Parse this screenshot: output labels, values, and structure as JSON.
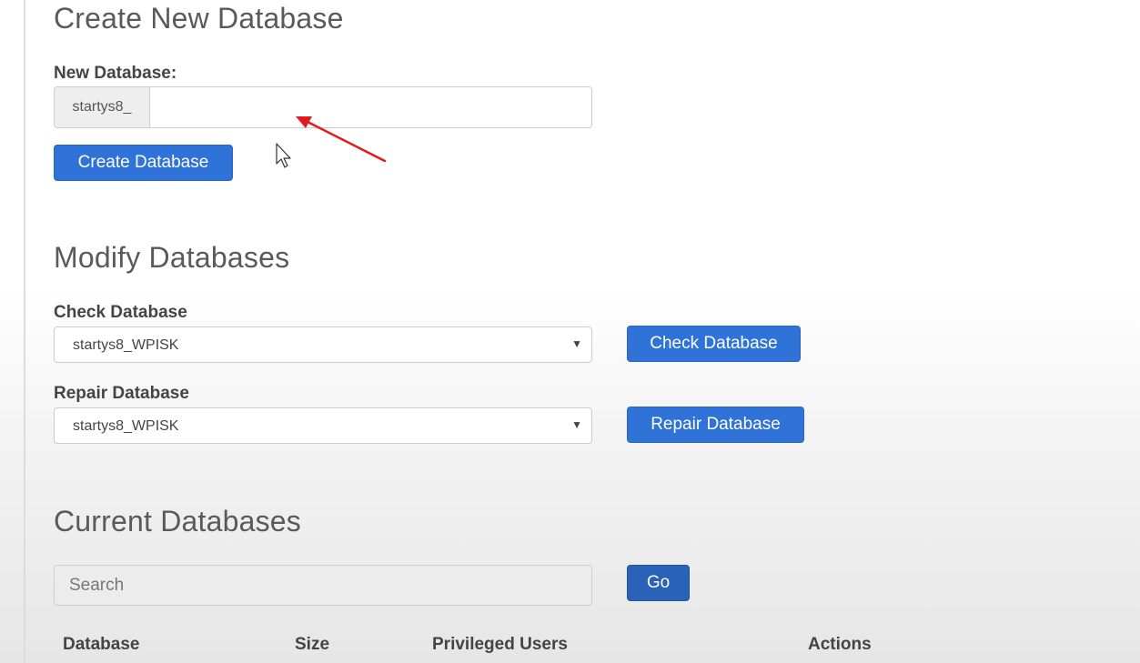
{
  "create_section": {
    "title": "Create New Database",
    "new_db_label": "New Database:",
    "prefix": "startys8_",
    "input_value": "",
    "button_label": "Create Database"
  },
  "modify_section": {
    "title": "Modify Databases",
    "check": {
      "label": "Check Database",
      "selected": "startys8_WPISK",
      "button_label": "Check Database"
    },
    "repair": {
      "label": "Repair Database",
      "selected": "startys8_WPISK",
      "button_label": "Repair Database"
    }
  },
  "current_section": {
    "title": "Current Databases",
    "search_placeholder": "Search",
    "go_label": "Go",
    "columns": [
      "Database",
      "Size",
      "Privileged Users",
      "Actions"
    ]
  },
  "colors": {
    "primary_button": "#2f72d8",
    "go_button": "#2a62b8",
    "annotation_arrow": "#e01b1b"
  },
  "icons": {
    "select_caret": "caret-down-icon",
    "cursor": "mouse-pointer-icon",
    "annotation": "red-arrow-icon"
  }
}
